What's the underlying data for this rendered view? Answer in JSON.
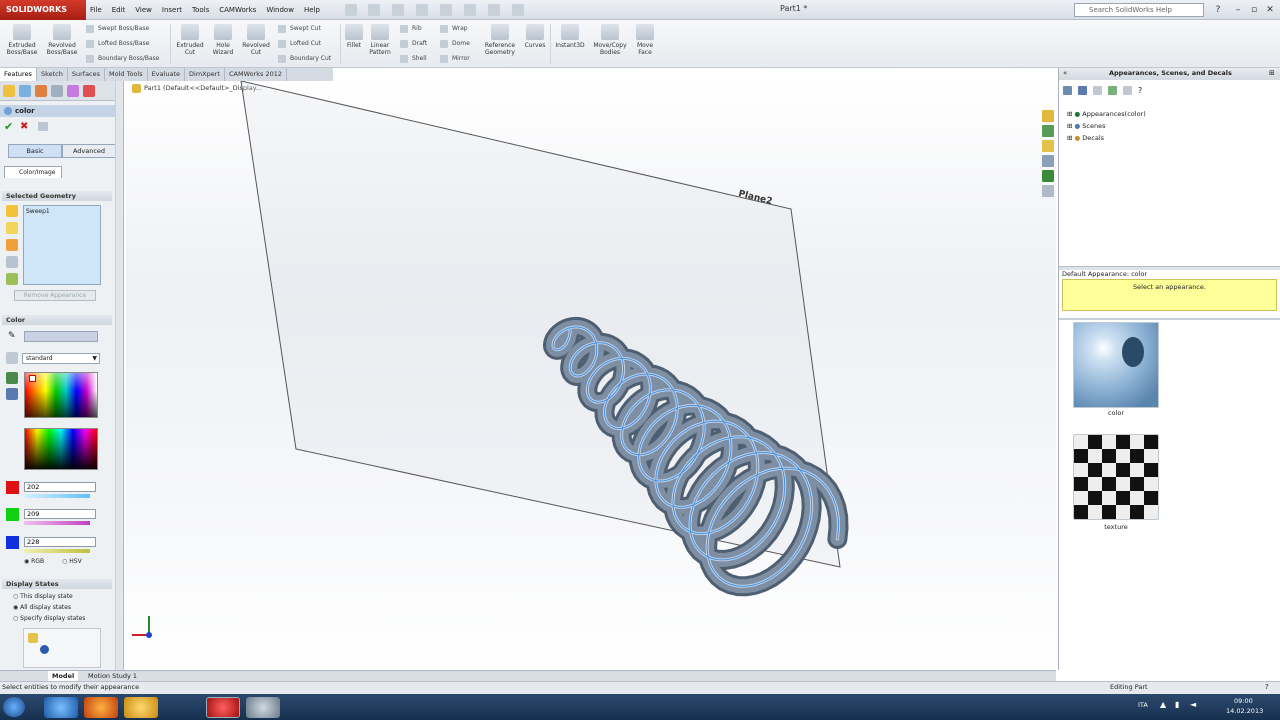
{
  "app": {
    "name": "SOLIDWORKS",
    "document_title": "Part1 *",
    "search_placeholder": "Search SolidWorks Help"
  },
  "menu": [
    "File",
    "Edit",
    "View",
    "Insert",
    "Tools",
    "CAMWorks",
    "Window",
    "Help"
  ],
  "ribbon": {
    "extruded_boss": "Extruded Boss/Base",
    "revolved_boss": "Revolved Boss/Base",
    "swept_boss": "Swept Boss/Base",
    "lofted_boss": "Lofted Boss/Base",
    "boundary_boss": "Boundary Boss/Base",
    "extruded_cut": "Extruded Cut",
    "hole_wizard": "Hole Wizard",
    "revolved_cut": "Revolved Cut",
    "swept_cut": "Swept Cut",
    "lofted_cut": "Lofted Cut",
    "boundary_cut": "Boundary Cut",
    "fillet": "Fillet",
    "linear_pattern": "Linear Pattern",
    "rib": "Rib",
    "draft": "Draft",
    "shell": "Shell",
    "wrap": "Wrap",
    "dome": "Dome",
    "mirror": "Mirror",
    "reference_geometry": "Reference Geometry",
    "curves": "Curves",
    "instant3d": "Instant3D",
    "move_copy": "Move/Copy Bodies",
    "move_face": "Move Face"
  },
  "tabs": [
    "Features",
    "Sketch",
    "Surfaces",
    "Mold Tools",
    "Evaluate",
    "DimXpert",
    "CAMWorks 2012"
  ],
  "left_panel": {
    "title": "color",
    "basic_tab": "Basic",
    "advanced_tab": "Advanced",
    "color_image_tab": "Color/Image",
    "selected_geometry_header": "Selected Geometry",
    "selected_item": "Sweep1",
    "remove_button": "Remove Appearance",
    "color_header": "Color",
    "palette_select": "standard",
    "red_value": "202",
    "green_value": "209",
    "blue_value": "228",
    "rgb_label": "RGB",
    "hsv_label": "HSV",
    "display_states_header": "Display States",
    "this_state": "This display state",
    "all_states": "All display states",
    "specify_states": "Specify display states",
    "colors": {
      "red": "#e01010",
      "green": "#10d010",
      "blue": "#1030e0"
    }
  },
  "graphics": {
    "breadcrumb": "Part1 (Default<<Default>_Display...",
    "plane_label": "Plane2",
    "spring_color": "#7e8ea3"
  },
  "right_panel": {
    "title": "Appearances, Scenes, and Decals",
    "tree": [
      "Appearances(color)",
      "Scenes",
      "Decals"
    ],
    "default_appearance": "Default Appearance: color",
    "select_prompt": "Select an appearance.",
    "thumb1_label": "color",
    "thumb2_label": "texture"
  },
  "bottom_tabs": [
    "Model",
    "Motion Study 1"
  ],
  "status": {
    "left": "Select entities to modify their appearance",
    "right": "Editing Part"
  },
  "taskbar": {
    "time": "09:00",
    "date": "14.02.2013",
    "lang": "ITA"
  }
}
